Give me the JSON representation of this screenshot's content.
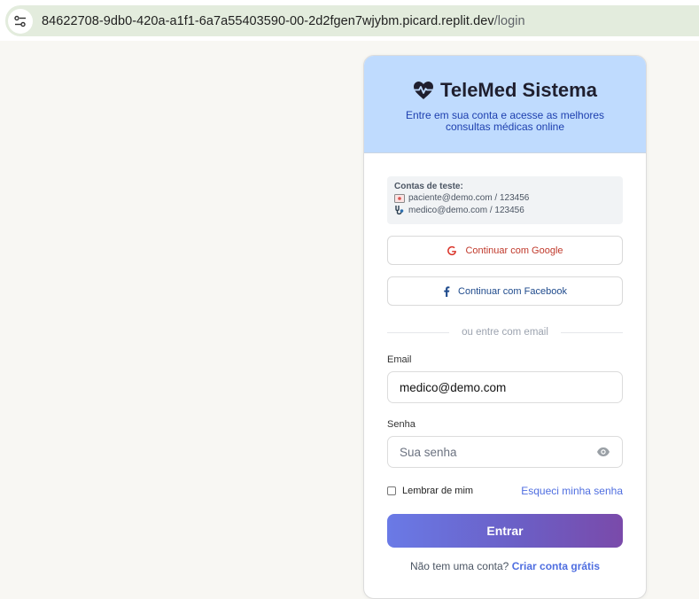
{
  "browser": {
    "url_host": "84622708-9db0-420a-a1f1-6a7a55403590-00-2d2fgen7wjybm.picard.replit.dev",
    "url_path": "/login",
    "site_info_icon": "tune-icon"
  },
  "header": {
    "brand_icon": "heart-pulse-icon",
    "brand_name": "TeleMed Sistema",
    "subtitle": "Entre em sua conta e acesse as melhores consultas médicas online"
  },
  "test_accounts": {
    "title": "Contas de teste:",
    "items": [
      {
        "icon": "patient-card-icon",
        "text": "paciente@demo.com / 123456"
      },
      {
        "icon": "stethoscope-icon",
        "text": "medico@demo.com / 123456"
      }
    ]
  },
  "social": {
    "google_label": "Continuar com Google",
    "facebook_label": "Continuar com Facebook"
  },
  "divider_text": "ou entre com email",
  "form": {
    "email_label": "Email",
    "email_value": "medico@demo.com",
    "password_label": "Senha",
    "password_placeholder": "Sua senha",
    "remember_label": "Lembrar de mim",
    "remember_checked": false,
    "forgot_label": "Esqueci minha senha",
    "submit_label": "Entrar"
  },
  "signup": {
    "prompt": "Não tem uma conta?",
    "link": "Criar conta grátis"
  },
  "colors": {
    "header_bg": "#bfdbfe",
    "accent": "#4f6ee0",
    "button_gradient_start": "#6a7ae6",
    "button_gradient_end": "#7a4aaa"
  }
}
